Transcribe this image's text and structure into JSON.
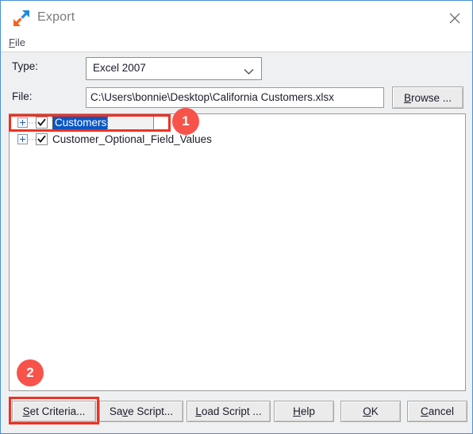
{
  "window": {
    "title": "Export",
    "icon": "export-arrows-icon",
    "close_icon": "close-icon",
    "accent_border": "#4a90d9",
    "body_bg": "#eff0f1"
  },
  "menubar": {
    "items": [
      {
        "label": "File",
        "accel": "F"
      }
    ]
  },
  "form": {
    "type": {
      "label": "Type:",
      "value": "Excel 2007",
      "arrow_icon": "chevron-down-icon"
    },
    "file": {
      "label": "File:",
      "value": "C:\\Users\\bonnie\\Desktop\\California Customers.xlsx",
      "placeholder": ""
    },
    "browse": {
      "label": "Browse ...",
      "accel": "B"
    }
  },
  "tree": {
    "nodes": [
      {
        "label": "Customers",
        "checked": true,
        "expandable": true,
        "selected": true,
        "editing": true,
        "expander_icon": "plus-box-icon",
        "check_icon": "checkmark-icon"
      },
      {
        "label": "Customer_Optional_Field_Values",
        "checked": true,
        "expandable": true,
        "selected": false,
        "editing": false,
        "expander_icon": "plus-box-icon",
        "check_icon": "checkmark-icon"
      }
    ]
  },
  "buttons": [
    {
      "name": "set-criteria",
      "label": "Set Criteria...",
      "accel": "S",
      "accel_index": 0
    },
    {
      "name": "save-script",
      "label": "Save Script...",
      "accel": "v",
      "accel_index": 2
    },
    {
      "name": "load-script",
      "label": "Load Script ...",
      "accel": "L",
      "accel_index": 0
    },
    {
      "name": "help",
      "label": "Help",
      "accel": "H",
      "accel_index": 0
    },
    {
      "name": "ok",
      "label": "OK",
      "accel": "O",
      "accel_index": 0
    },
    {
      "name": "cancel",
      "label": "Cancel",
      "accel": "C",
      "accel_index": 0
    }
  ],
  "annotations": {
    "color": "#ee3124",
    "badge_color": "#f8534a",
    "badges": [
      {
        "number": "1",
        "target": "customers-tree-row"
      },
      {
        "number": "2",
        "target": "set-criteria-button"
      }
    ]
  }
}
